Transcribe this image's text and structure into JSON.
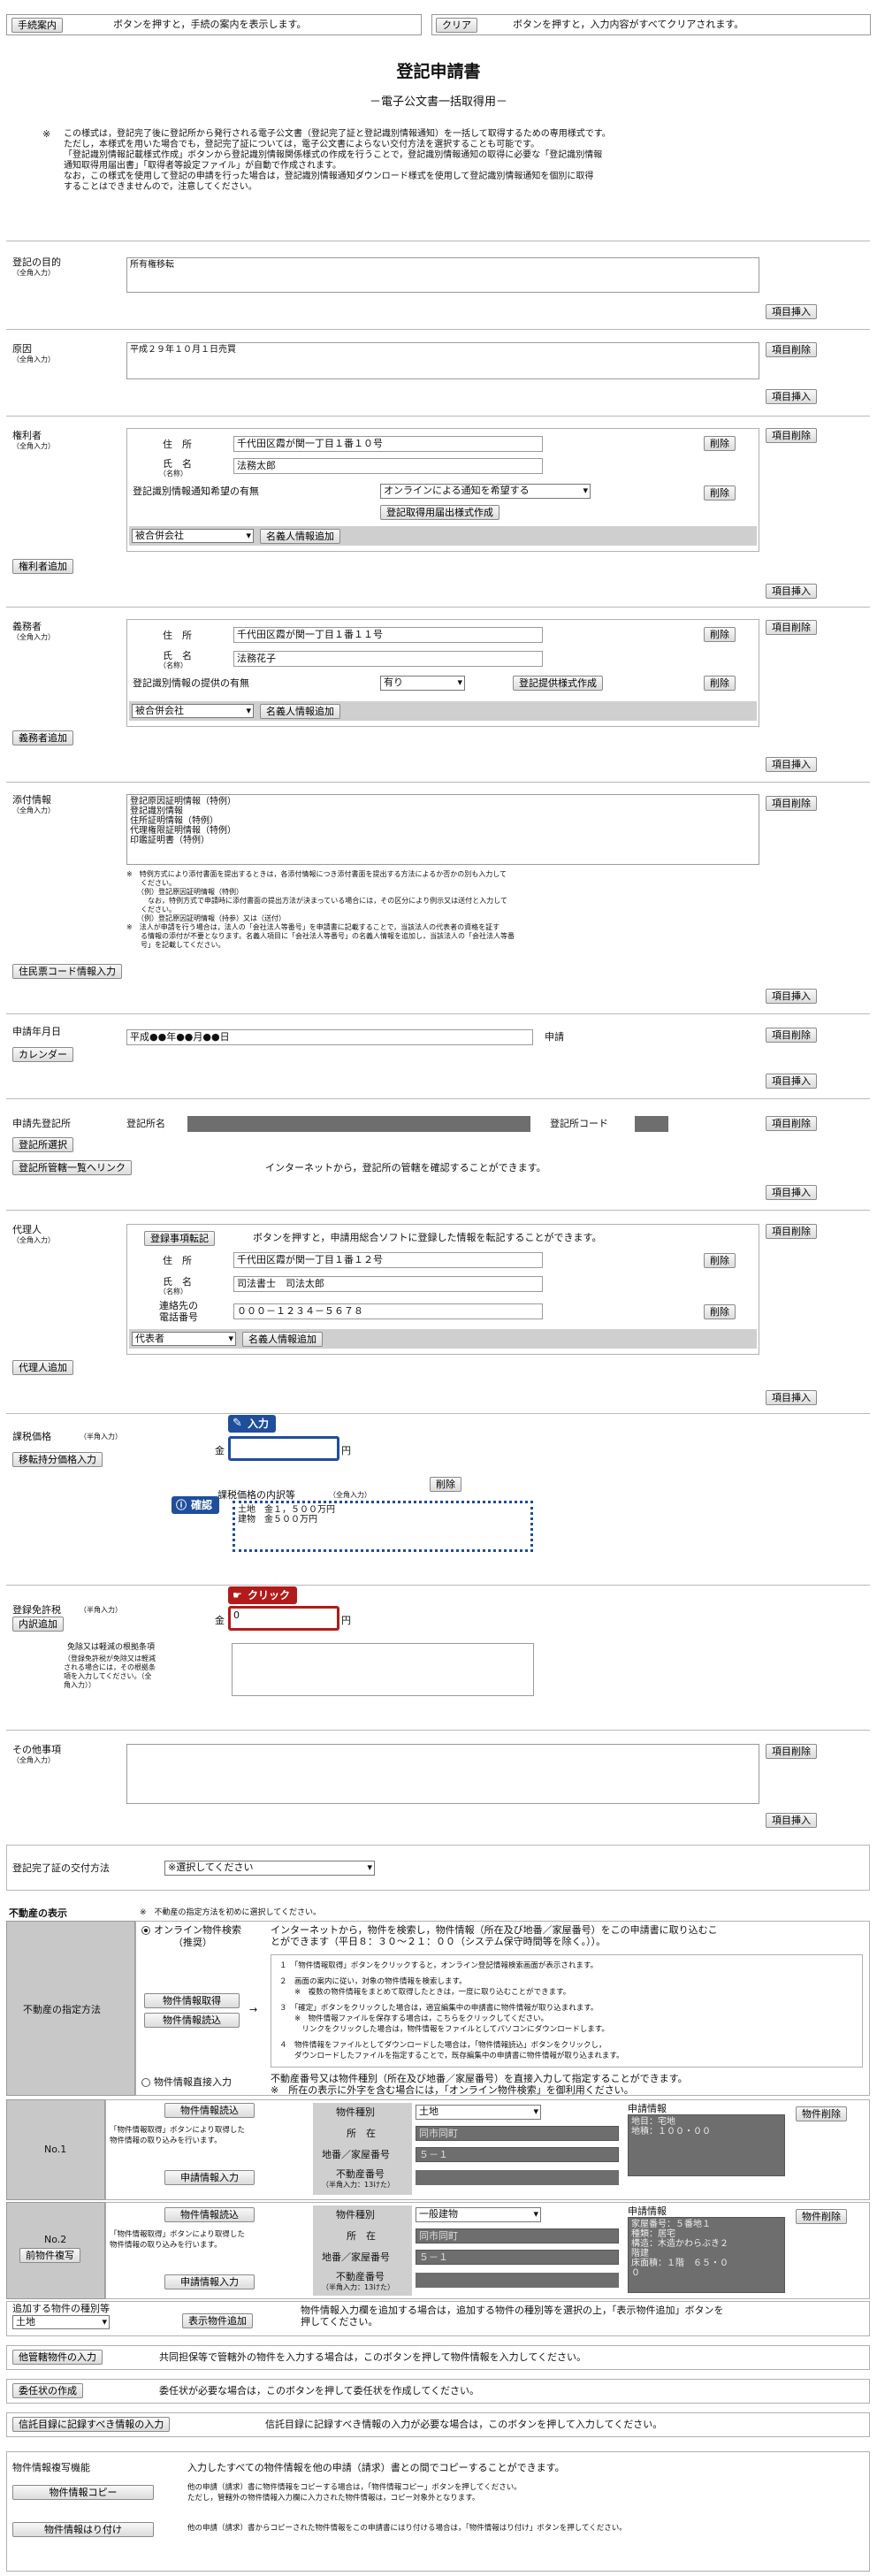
{
  "top": {
    "guide_button": "手続案内",
    "guide_text": "ボタンを押すと，手続の案内を表示します。",
    "clear_button": "クリア",
    "clear_text": "ボタンを押すと，入力内容がすべてクリアされます。"
  },
  "header": {
    "title": "登記申請書",
    "subtitle": "－電子公文書一括取得用－",
    "note_mark": "※",
    "note_lines": [
      "この様式は，登記完了後に登記所から発行される電子公文書（登記完了証と登記識別情報通知）を一括して取得するための専用様式です。",
      "ただし，本様式を用いた場合でも，登記完了証については，電子公文書によらない交付方法を選択することも可能です。",
      "「登記識別情報記載様式作成」ボタンから登記識別情報関係様式の作成を行うことで，登記識別情報通知の取得に必要な「登記識別情報",
      "通知取得用届出書」「取得者等設定ファイル」が自動で作成されます。",
      "なお，この様式を使用して登記の申請を行った場合は，登記識別情報通知ダウンロード様式を使用して登記識別情報通知を個別に取得",
      "することはできませんので，注意してください。"
    ]
  },
  "common": {
    "item_insert": "項目挿入",
    "item_delete": "項目削除",
    "delete": "削除",
    "zenkaku": "（全角入力）"
  },
  "purpose": {
    "label": "登記の目的",
    "value": "所有権移転"
  },
  "cause": {
    "label": "原因",
    "value": "平成２９年１０月１日売買"
  },
  "rightholder": {
    "label": "権利者",
    "address_label": "住　所",
    "address": "千代田区霞が関一丁目１番１０号",
    "name_label": "氏　名",
    "name_sub": "（名称）",
    "name": "法務太郎",
    "notice_label": "登記識別情報通知希望の有無",
    "notice_value": "オンラインによる通知を希望する",
    "form_button": "登記取得用届出様式作成",
    "merge_value": "被合併会社",
    "nominee_button": "名義人情報追加",
    "add_button": "権利者追加"
  },
  "obligor": {
    "label": "義務者",
    "address_label": "住　所",
    "address": "千代田区霞が関一丁目１番１１号",
    "name_label": "氏　名",
    "name_sub": "（名称）",
    "name": "法務花子",
    "provide_label": "登記識別情報の提供の有無",
    "provide_value": "有り",
    "form_button": "登記提供様式作成",
    "merge_value": "被合併会社",
    "nominee_button": "名義人情報追加",
    "add_button": "義務者追加"
  },
  "attachments": {
    "label": "添付情報",
    "items": "登記原因証明情報（特例）\n登記識別情報\n住所証明情報（特例）\n代理権限証明情報（特例）\n印鑑証明書（特例）",
    "note_lines": [
      "※　特例方式により添付書面を提出するときは，各添付情報につき添付書面を提出する方法によるか否かの別も入力して",
      "　　ください。",
      "　　（例）登記原因証明情報（特例）",
      "　　　なお，特例方式で申請時に添付書面の提出方法が決まっている場合には，その区分により例示又は送付と入力して",
      "　　ください。",
      "　　（例）登記原因証明情報（持参）又は（送付）",
      "※　法人が申請を行う場合は，法人の「会社法人等番号」を申請書に記載することで，当該法人の代表者の資格を証す",
      "　　る情報の添付が不要となります。名義人項目に「会社法人等番号」の名義人情報を追加し，当該法人の「会社法人等番",
      "　　号」を記載してください。"
    ],
    "resident_button": "住民票コード情報入力"
  },
  "date": {
    "label": "申請年月日",
    "value": "平成●●年●●月●●日",
    "suffix": "申請",
    "calendar": "カレンダー"
  },
  "office": {
    "label": "申請先登記所",
    "name_label": "登記所名",
    "code_label": "登記所コード",
    "select_button": "登記所選択",
    "link_button": "登記所管轄一覧へリンク",
    "link_text": "インターネットから，登記所の管轄を確認することができます。"
  },
  "agent": {
    "label": "代理人",
    "transfer_button": "登録事項転記",
    "transfer_text": "ボタンを押すと，申請用総合ソフトに登録した情報を転記することができます。",
    "address_label": "住　所",
    "address": "千代田区霞が関一丁目１番１２号",
    "name_label": "氏　名",
    "name_sub": "（名称）",
    "name": "司法書士　司法太郎",
    "tel_label1": "連絡先の",
    "tel_label2": "電話番号",
    "tel": "０００－１２３４－５６７８",
    "rep_value": "代表者",
    "nominee_button": "名義人情報追加",
    "add_button": "代理人追加"
  },
  "tax": {
    "label": "課税価格",
    "label_sub": "（半角入力）",
    "transfer_button": "移転持分価格入力",
    "yen_prefix": "金",
    "yen_suffix": "円",
    "value": "",
    "detail_label": "課税価格の内訳等",
    "detail_sub": "（全角入力）",
    "detail_value": "土地　金１，５００万円\n建物　金５００万円",
    "callout_input": "入力",
    "callout_confirm": "確認"
  },
  "license": {
    "label": "登録免許税",
    "label_sub": "（半角入力）",
    "detail_button": "内訳追加",
    "yen_prefix": "金",
    "yen_suffix": "円",
    "value": "0",
    "callout_click": "クリック",
    "basis_lines": [
      "免除又は軽減の根拠条項",
      "（登録免許税が免除又は軽減",
      "される場合には，その根拠条",
      "項を入力してください。（全",
      "角入力））"
    ]
  },
  "other": {
    "label": "その他事項"
  },
  "delivery": {
    "label": "登記完了証の交付方法",
    "value": "※選択してください"
  },
  "property": {
    "section_title": "不動産の表示",
    "section_note": "※　不動産の指定方法を初めに選択してください。",
    "method_label": "不動産の指定方法",
    "radio_online": "オンライン物件検索",
    "radio_online_sub": "（推奨）",
    "online_text1": "インターネットから，物件を検索し，物件情報（所在及び地番／家屋番号）をこの申請書に取り込むこ",
    "online_text2": "とができます（平日８：３０～２１：００（システム保守時間等を除く。））。",
    "get_button": "物件情報取得",
    "load_button": "物件情報読込",
    "arrow": "→",
    "steps": [
      "１　「物件情報取得」ボタンをクリックすると，オンライン登記情報検索画面が表示されます。",
      "２　画面の案内に従い，対象の物件情報を検索します。",
      "　　※　複数の物件情報をまとめて取得したときは，一度に取り込むことができます。",
      "３　「確定」ボタンをクリックした場合は，適宜編集中の申請書に物件情報が取り込まれます。",
      "　　※　物件情報ファイルを保存する場合は，こちらをクリックしてください。",
      "　　　リンクをクリックした場合は，物件情報をファイルとしてパソコンにダウンロードします。",
      "４　物件情報をファイルとしてダウンロードした場合は，「物件情報読込」ボタンをクリックし，",
      "　　ダウンロードしたファイルを指定することで，既存編集中の申請書に物件情報が取り込まれます。"
    ],
    "radio_direct": "物件情報直接入力",
    "direct_text1": "不動産番号又は物件種別（所在及び地番／家屋番号）を直接入力して指定することができます。",
    "direct_text2": "※　所在の表示に外字を含む場合には，「オンライン物件検索」を御利用ください。",
    "app_info_label": "申請情報",
    "item_delete": "物件削除",
    "kind_label": "物件種別",
    "loc_label": "所　在",
    "lot_label": "地番／家屋番号",
    "num_label": "不動産番号",
    "num_sub": "（半角入力：13けた）",
    "load_button2": "物件情報読込",
    "load_note1": "「物件情報取得」ボタンにより取得した",
    "load_note2": "物件情報の取り込みを行います。",
    "app_button": "申請情報入力",
    "rows": [
      {
        "no": "No.1",
        "kind": "土地",
        "loc": "同市同町",
        "lot": "５－１",
        "app_info": "地目：宅地\n地積：１００・００",
        "copy_button": ""
      },
      {
        "no": "No.2",
        "kind": "一般建物",
        "loc": "同市同町",
        "lot": "５－１",
        "app_info": "家屋番号：５番地１\n種類：居宅\n構造：木造かわらぶき２\n階建\n床面積：１階　６５・０\n０",
        "copy_button": "前物件複写"
      }
    ],
    "add_kind_label": "追加する物件の種別等",
    "add_kind_value": "土地",
    "add_button": "表示物件追加",
    "add_text1": "物件情報入力欄を追加する場合は，追加する物件の種別等を選択の上，「表示物件追加」ボタンを",
    "add_text2": "押してください。"
  },
  "bottom": {
    "other_jur_button": "他管轄物件の入力",
    "other_jur_text": "共同担保等で管轄外の物件を入力する場合は，このボタンを押して物件情報を入力してください。",
    "proxy_button": "委任状の作成",
    "proxy_text": "委任状が必要な場合は，このボタンを押して委任状を作成してください。",
    "trust_button": "信託目録に記録すべき情報の入力",
    "trust_text": "信託目録に記録すべき情報の入力が必要な場合は，このボタンを押して入力してください。",
    "copy_title": "物件情報複写機能",
    "copy_text": "入力したすべての物件情報を他の申請（請求）書との間でコピーすることができます。",
    "copy_button": "物件情報コピー",
    "copy_note1": "他の申請（請求）書に物件情報をコピーする場合は，「物件情報コピー」ボタンを押してください。",
    "copy_note2": "ただし，管轄外の物件情報入力欄に入力された物件情報は，コピー対象外となります。",
    "paste_button": "物件情報はり付け",
    "paste_note": "他の申請（請求）書からコピーされた物件情報をこの申請書にはり付ける場合は，「物件情報はり付け」ボタンを押してください。"
  },
  "colors": {
    "callout_blue": "#1f4e9c",
    "callout_red": "#b31b1b"
  }
}
